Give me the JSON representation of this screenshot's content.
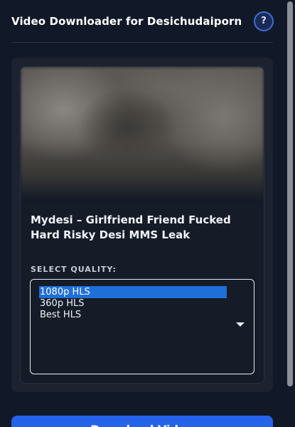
{
  "header": {
    "title": "Video Downloader for Desichudaiporn",
    "help_label": "?"
  },
  "video": {
    "title": "Mydesi – Girlfriend Friend Fucked Hard Risky Desi MMS Leak"
  },
  "quality": {
    "label": "SELECT QUALITY:",
    "options": [
      "1080p HLS",
      "360p HLS",
      "Best HLS"
    ],
    "selected": "1080p HLS"
  },
  "actions": {
    "download_label": "Download Video"
  },
  "colors": {
    "background": "#111827",
    "panel": "#1c2230",
    "accent": "#2563eb",
    "selection": "#1f6fd8"
  }
}
